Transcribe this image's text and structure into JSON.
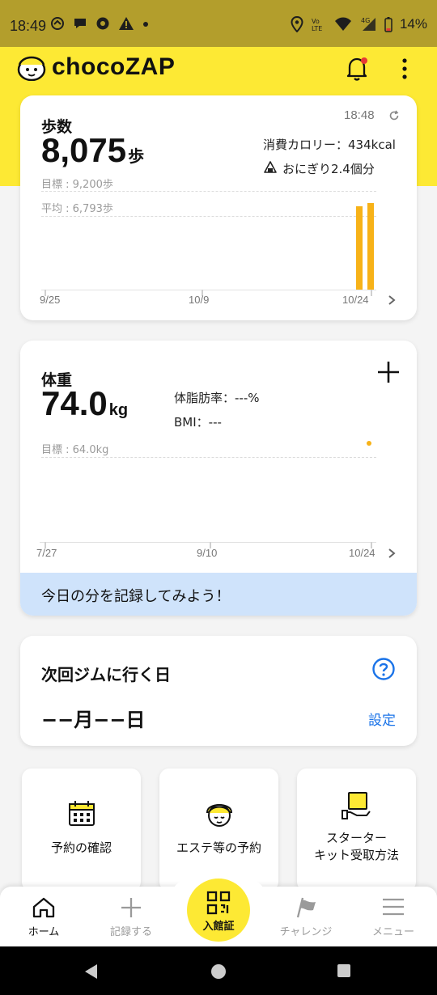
{
  "status_bar": {
    "time": "18:49",
    "battery": "14%",
    "network": "4G"
  },
  "app": {
    "logo_text": "chocoZAP"
  },
  "steps_card": {
    "title": "歩数",
    "value": "8,075",
    "unit": "歩",
    "updated_time": "18:48",
    "calories": "消費カロリー：434kcal",
    "onigiri": "おにぎり2.4個分",
    "goal_label": "目標 : 9,200歩",
    "avg_label": "平均 : 6,793歩",
    "x_labels": [
      "9/25",
      "10/9",
      "10/24"
    ],
    "chart_data": {
      "type": "bar",
      "goal": 9200,
      "average": 6793,
      "ylim": [
        0,
        11000
      ],
      "bars": [
        {
          "day_offset": 28,
          "value": 7800
        },
        {
          "day_offset": 29,
          "value": 8075
        }
      ],
      "x_range_days": 29
    }
  },
  "weight_card": {
    "title": "体重",
    "value": "74.0",
    "unit": "kg",
    "body_fat": "体脂肪率：---%",
    "bmi": "BMI：---",
    "goal_label": "目標 : 64.0kg",
    "x_labels": [
      "7/27",
      "9/10",
      "10/24"
    ],
    "hint": "今日の分を記録してみよう！",
    "chart_data": {
      "type": "scatter",
      "goal": 64.0,
      "points": [
        {
          "date": "10/24",
          "value": 74.0
        }
      ]
    }
  },
  "gym_card": {
    "title": "次回ジムに行く日",
    "date_text": "−−月−−日",
    "setting_label": "設定"
  },
  "tiles": [
    {
      "label": "予約の確認",
      "icon": "calendar-icon"
    },
    {
      "label": "エステ等の予約",
      "icon": "face-towel-icon"
    },
    {
      "label_line1": "スターター",
      "label_line2": "キット受取方法",
      "icon": "package-hand-icon"
    }
  ],
  "nav": {
    "home": "ホーム",
    "record": "記録する",
    "entry": "入館証",
    "challenge": "チャレンジ",
    "menu": "メニュー"
  },
  "colors": {
    "accent_yellow": "#fde934",
    "bar_orange": "#f7b218",
    "link_blue": "#1a73e8",
    "hint_bg": "#cfe3fb"
  }
}
